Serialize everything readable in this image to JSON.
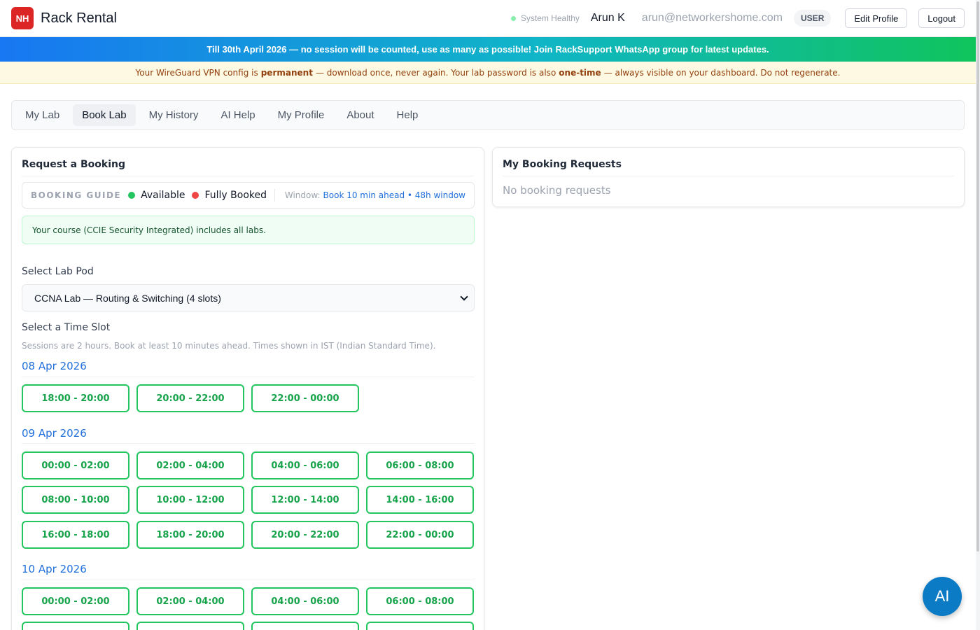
{
  "header": {
    "logo_text": "NH",
    "app_title": "Rack Rental",
    "system_status": "System Healthy",
    "user_name": "Arun K",
    "user_email": "arun@networkershome.com",
    "role": "USER",
    "edit_profile_label": "Edit Profile",
    "logout_label": "Logout"
  },
  "banner_promo": {
    "text_before": "Till 30th April 2026 — no session will be counted, use as many as possible! Join",
    "highlight": "RackSupport",
    "text_after": "WhatsApp group for latest updates."
  },
  "banner_notice": {
    "part1": "Your WireGuard VPN config is",
    "bold1": "permanent",
    "part2": "— download once, never again. Your lab password is also",
    "bold2": "one-time",
    "part3": "— always visible on your dashboard. Do not regenerate."
  },
  "tabs": [
    {
      "label": "My Lab",
      "active": false
    },
    {
      "label": "Book Lab",
      "active": true
    },
    {
      "label": "My History",
      "active": false
    },
    {
      "label": "AI Help",
      "active": false
    },
    {
      "label": "My Profile",
      "active": false
    },
    {
      "label": "About",
      "active": false
    },
    {
      "label": "Help",
      "active": false
    }
  ],
  "booking": {
    "title": "Request a Booking",
    "guide_label": "BOOKING GUIDE",
    "available_label": "Available",
    "booked_label": "Fully Booked",
    "window_label": "Window:",
    "window_value": "Book 10 min ahead • 48h window",
    "course_info": "Your course (CCIE Security Integrated) includes all labs.",
    "select_pod_label": "Select Lab Pod",
    "selected_pod": "CCNA Lab — Routing & Switching (4 slots)",
    "select_slot_label": "Select a Time Slot",
    "slot_hint": "Sessions are 2 hours. Book at least 10 minutes ahead. Times shown in IST (Indian Standard Time).",
    "dates": [
      {
        "date": "08 Apr 2026",
        "slots": [
          "18:00 - 20:00",
          "20:00 - 22:00",
          "22:00 - 00:00"
        ]
      },
      {
        "date": "09 Apr 2026",
        "slots": [
          "00:00 - 02:00",
          "02:00 - 04:00",
          "04:00 - 06:00",
          "06:00 - 08:00",
          "08:00 - 10:00",
          "10:00 - 12:00",
          "12:00 - 14:00",
          "14:00 - 16:00",
          "16:00 - 18:00",
          "18:00 - 20:00",
          "20:00 - 22:00",
          "22:00 - 00:00"
        ]
      },
      {
        "date": "10 Apr 2026",
        "slots": [
          "00:00 - 02:00",
          "02:00 - 04:00",
          "04:00 - 06:00",
          "06:00 - 08:00"
        ]
      }
    ]
  },
  "requests": {
    "title": "My Booking Requests",
    "empty_text": "No booking requests"
  },
  "fab_label": "AI",
  "colors": {
    "accent_blue": "#1f6fdb",
    "available_green": "#22c55e",
    "booked_red": "#ef4444",
    "logo_red": "#dc2626",
    "fab_blue": "#0b7bc6"
  }
}
